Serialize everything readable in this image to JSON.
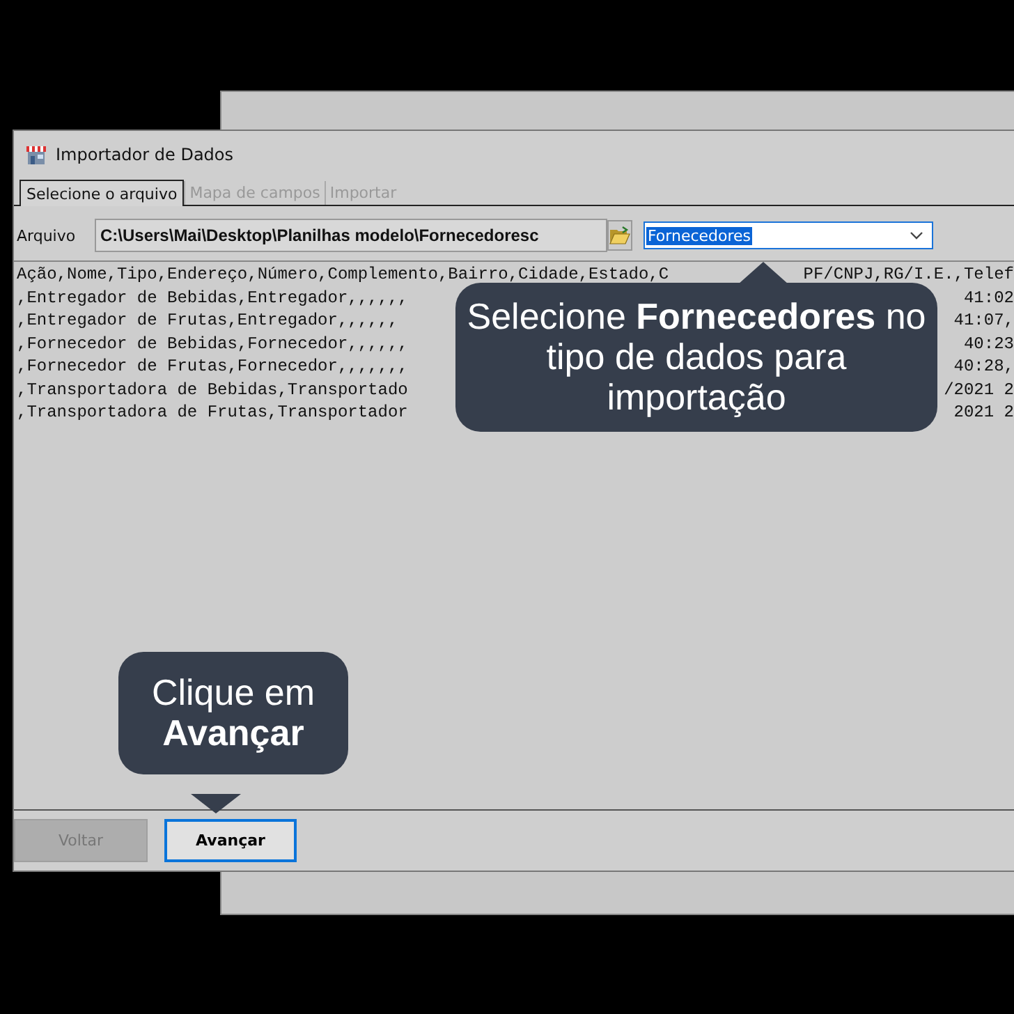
{
  "window": {
    "title": "Importador de Dados"
  },
  "tabs": [
    {
      "label": "Selecione o arquivo",
      "selected": true
    },
    {
      "label": "Mapa de campos",
      "selected": false
    },
    {
      "label": "Importar",
      "selected": false
    }
  ],
  "file_field": {
    "label": "Arquivo",
    "value": "C:\\Users\\Mai\\Desktop\\Planilhas modelo\\Fornecedoresc"
  },
  "data_type": {
    "value": "Fornecedores"
  },
  "preview_lines": [
    {
      "left": "Ação,Nome,Tipo,Endereço,Número,Complemento,Bairro,Cidade,Estado,C",
      "right": "PF/CNPJ,RG/I.E.,Telef"
    },
    {
      "left": ",Entregador de Bebidas,Entregador,,,,,,",
      "right": "41:02"
    },
    {
      "left": ",Entregador de Frutas,Entregador,,,,,,",
      "right": "41:07,"
    },
    {
      "left": ",Fornecedor de Bebidas,Fornecedor,,,,,,",
      "right": "40:23"
    },
    {
      "left": ",Fornecedor de Frutas,Fornecedor,,,,,,,",
      "right": "40:28,"
    },
    {
      "left": ",Transportadora de Bebidas,Transportado",
      "right": "/2021 2"
    },
    {
      "left": ",Transportadora de Frutas,Transportador",
      "right": "2021 2"
    }
  ],
  "buttons": [
    {
      "label": "Voltar",
      "disabled": true,
      "focused": false
    },
    {
      "label": "Avançar",
      "disabled": false,
      "focused": true
    }
  ],
  "callouts": [
    {
      "text": "Selecione **Fornecedores** no tipo de dados para importação",
      "kind": "arrow-up"
    },
    {
      "text": "Clique em **Avançar**",
      "kind": "arrow-down"
    }
  ]
}
